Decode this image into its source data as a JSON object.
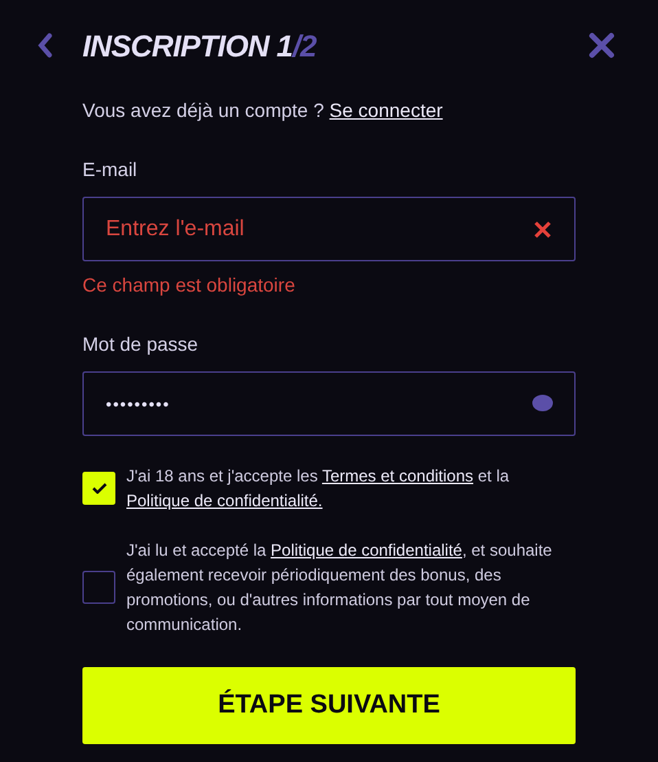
{
  "header": {
    "title": "INSCRIPTION 1",
    "step": "/2"
  },
  "login_prompt": [
    {
      "text": "Vous avez déjà un compte ? ",
      "link": false
    },
    {
      "text": "Se connecter",
      "link": true
    }
  ],
  "email": {
    "label": "E-mail",
    "placeholder": "Entrez l'e-mail",
    "error": "Ce champ est obligatoire"
  },
  "password": {
    "label": "Mot de passe",
    "value": "•••••••••"
  },
  "consents": [
    {
      "checked": true,
      "parts": [
        {
          "text": "J'ai 18 ans et j'accepte les ",
          "link": false
        },
        {
          "text": "Termes et conditions",
          "link": true
        },
        {
          "text": " et la ",
          "link": false
        },
        {
          "text": "Politique de confidentialité.",
          "link": true
        }
      ]
    },
    {
      "checked": false,
      "parts": [
        {
          "text": "J'ai lu et accepté la ",
          "link": false
        },
        {
          "text": "Politique de confidentialité",
          "link": true
        },
        {
          "text": ", et souhaite également recevoir périodiquement des bonus, des promotions, ou d'autres informations par tout moyen de communication.",
          "link": false
        }
      ]
    }
  ],
  "submit": "ÉTAPE SUIVANTE"
}
